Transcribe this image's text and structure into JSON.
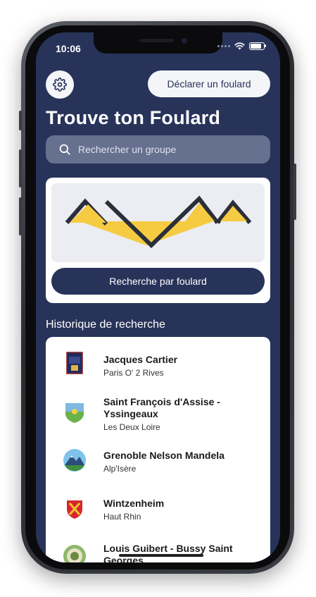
{
  "status_bar": {
    "time": "10:06"
  },
  "header": {
    "settings_icon": "gear-icon",
    "declare_label": "Déclarer un foulard",
    "title": "Trouve ton Foulard"
  },
  "search": {
    "placeholder": "Rechercher un groupe",
    "icon": "search-icon"
  },
  "foulard_card": {
    "button_label": "Recherche par foulard",
    "colors": {
      "yellow": "#f5cb42",
      "dark": "#2a2f3a"
    }
  },
  "history": {
    "title": "Historique de recherche",
    "items": [
      {
        "name": "Jacques Cartier",
        "sub": "Paris O' 2 Rives",
        "logo": "group-logo"
      },
      {
        "name": "Saint François d'Assise - Yssingeaux",
        "sub": "Les Deux Loire",
        "logo": "group-logo"
      },
      {
        "name": "Grenoble Nelson Mandela",
        "sub": "Alp'Isère",
        "logo": "group-logo"
      },
      {
        "name": "Wintzenheim",
        "sub": "Haut Rhin",
        "logo": "group-logo"
      },
      {
        "name": "Louis Guibert - Bussy Saint Georges",
        "sub": "",
        "logo": "group-logo"
      }
    ]
  },
  "colors": {
    "background": "#28335a",
    "card": "#ffffff",
    "search_bg": "#66708f"
  }
}
